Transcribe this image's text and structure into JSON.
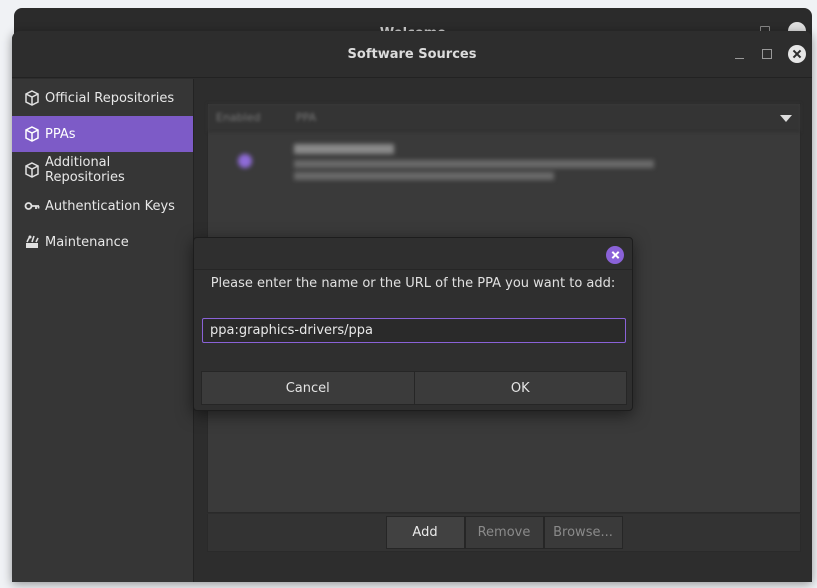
{
  "background_window": {
    "title": "Welcome"
  },
  "window": {
    "title": "Software Sources"
  },
  "sidebar": {
    "items": [
      {
        "label": "Official Repositories",
        "icon": "package-icon",
        "active": false
      },
      {
        "label": "PPAs",
        "icon": "package-icon",
        "active": true
      },
      {
        "label": "Additional Repositories",
        "icon": "package-icon",
        "active": false
      },
      {
        "label": "Authentication Keys",
        "icon": "key-icon",
        "active": false
      },
      {
        "label": "Maintenance",
        "icon": "maintenance-icon",
        "active": false
      }
    ]
  },
  "ppa_list": {
    "columns": [
      "Enabled",
      "PPA"
    ]
  },
  "toolbar": {
    "add_label": "Add",
    "remove_label": "Remove",
    "browse_label": "Browse..."
  },
  "dialog": {
    "message": "Please enter the name or the URL of the PPA you want to add:",
    "input_value": "ppa:graphics-drivers/ppa",
    "cancel_label": "Cancel",
    "ok_label": "OK"
  },
  "colors": {
    "accent": "#7d5bc7",
    "window_bg": "#2d2d2d",
    "sidebar_bg": "#363636"
  }
}
